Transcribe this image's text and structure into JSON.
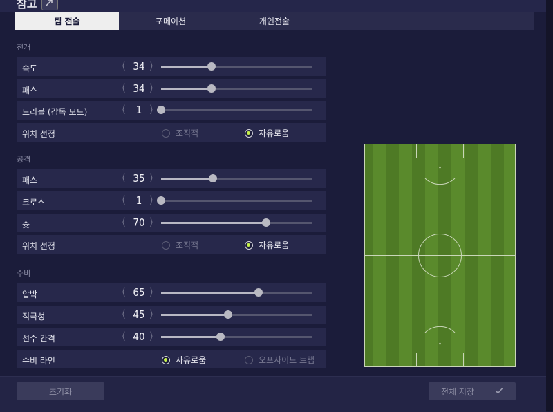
{
  "header": {
    "title": "참고"
  },
  "tabs": [
    {
      "label": "팀 전술",
      "active": true
    },
    {
      "label": "포메이션",
      "active": false
    },
    {
      "label": "개인전술",
      "active": false
    }
  ],
  "sections": {
    "buildup": {
      "label": "전개",
      "speed": {
        "label": "속도",
        "value": 34
      },
      "passing": {
        "label": "패스",
        "value": 34
      },
      "dribbling": {
        "label": "드리블 (감독 모드)",
        "value": 1
      },
      "positioning": {
        "label": "위치 선정",
        "options": [
          "조직적",
          "자유로움"
        ],
        "selected": "자유로움"
      }
    },
    "attack": {
      "label": "공격",
      "passing": {
        "label": "패스",
        "value": 35
      },
      "crossing": {
        "label": "크로스",
        "value": 1
      },
      "shooting": {
        "label": "슛",
        "value": 70
      },
      "positioning": {
        "label": "위치 선정",
        "options": [
          "조직적",
          "자유로움"
        ],
        "selected": "자유로움"
      }
    },
    "defence": {
      "label": "수비",
      "pressure": {
        "label": "압박",
        "value": 65
      },
      "aggression": {
        "label": "적극성",
        "value": 45
      },
      "width": {
        "label": "선수 간격",
        "value": 40
      },
      "line": {
        "label": "수비 라인",
        "options": [
          "자유로움",
          "오프사이드 트랩"
        ],
        "selected": "자유로움"
      }
    }
  },
  "footer": {
    "reset_label": "초기화",
    "save_label": "전체 저장"
  },
  "colors": {
    "accent": "#c7f24b",
    "pitch_dark": "#4e7a25",
    "pitch_light": "#5a8a2c",
    "background": "#1b1c3a"
  }
}
